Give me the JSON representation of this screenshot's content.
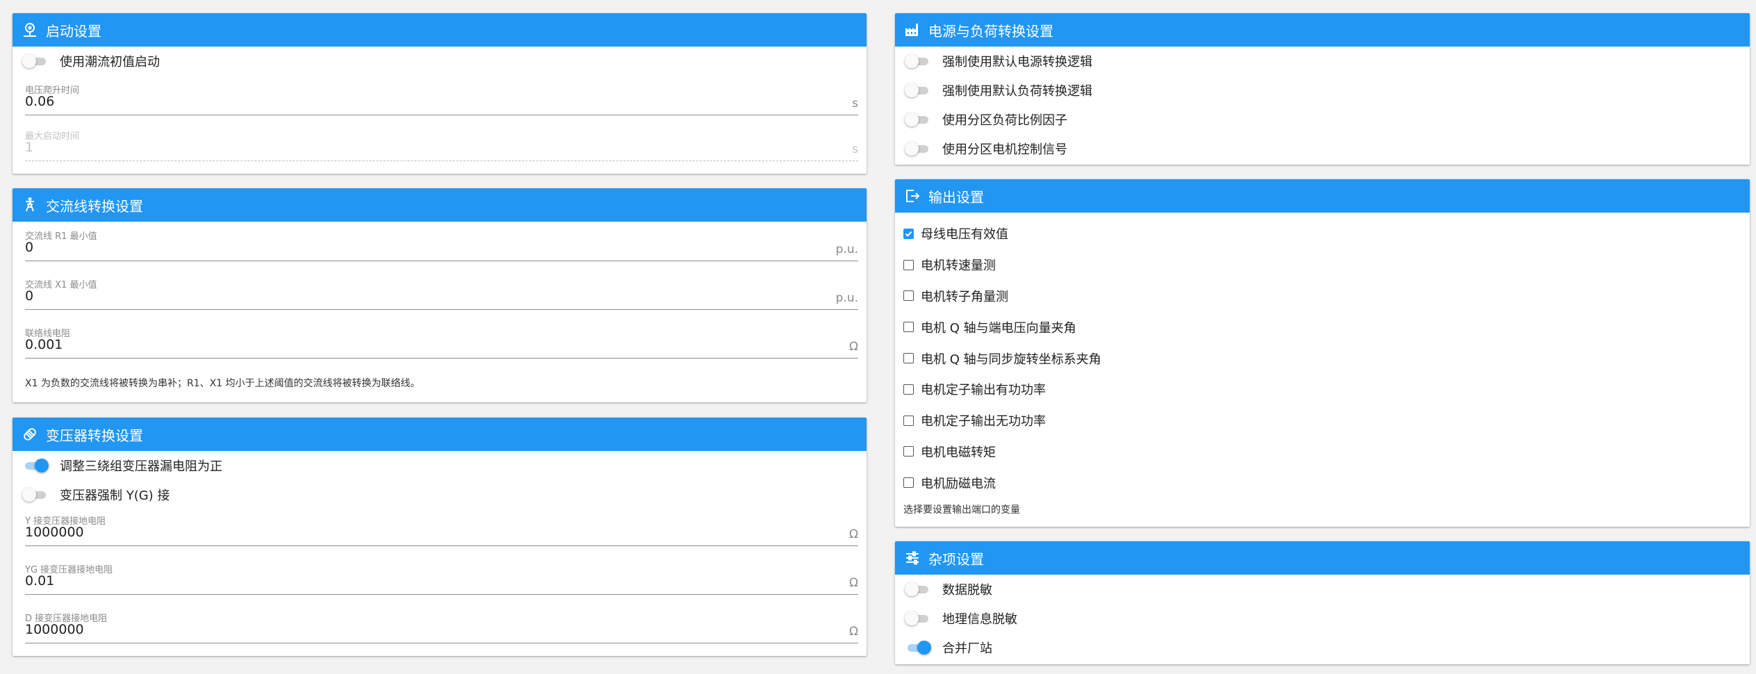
{
  "startup": {
    "title": "启动设置",
    "toggle_label": "使用潮流初值启动",
    "toggle_on": false,
    "voltage_rise": {
      "label": "电压爬升时间",
      "value": "0.06",
      "unit": "s"
    },
    "max_start": {
      "label": "最大启动时间",
      "value": "1",
      "unit": "s"
    }
  },
  "acline": {
    "title": "交流线转换设置",
    "r1": {
      "label": "交流线 R1 最小值",
      "value": "0",
      "unit": "p.u."
    },
    "x1": {
      "label": "交流线 X1 最小值",
      "value": "0",
      "unit": "p.u."
    },
    "tie": {
      "label": "联络线电阻",
      "value": "0.001",
      "unit": "Ω"
    },
    "hint": "X1 为负数的交流线将被转换为串补；R1、X1 均小于上述阈值的交流线将被转换为联络线。"
  },
  "transformer": {
    "title": "变压器转换设置",
    "toggles": [
      {
        "label": "调整三绕组变压器漏电阻为正",
        "on": true
      },
      {
        "label": "变压器强制 Y(G) 接",
        "on": false
      }
    ],
    "y_ground": {
      "label": "Y 接变压器接地电阻",
      "value": "1000000",
      "unit": "Ω"
    },
    "yg_ground": {
      "label": "YG 接变压器接地电阻",
      "value": "0.01",
      "unit": "Ω"
    },
    "d_ground": {
      "label": "D 接变压器接地电阻",
      "value": "1000000",
      "unit": "Ω"
    }
  },
  "power_load": {
    "title": "电源与负荷转换设置",
    "toggles": [
      {
        "label": "强制使用默认电源转换逻辑",
        "on": false
      },
      {
        "label": "强制使用默认负荷转换逻辑",
        "on": false
      },
      {
        "label": "使用分区负荷比例因子",
        "on": false
      },
      {
        "label": "使用分区电机控制信号",
        "on": false
      }
    ]
  },
  "output": {
    "title": "输出设置",
    "checks": [
      {
        "label": "母线电压有效值",
        "checked": true
      },
      {
        "label": "电机转速量测",
        "checked": false
      },
      {
        "label": "电机转子角量测",
        "checked": false
      },
      {
        "label": "电机 Q 轴与端电压向量夹角",
        "checked": false
      },
      {
        "label": "电机 Q 轴与同步旋转坐标系夹角",
        "checked": false
      },
      {
        "label": "电机定子输出有功功率",
        "checked": false
      },
      {
        "label": "电机定子输出无功功率",
        "checked": false
      },
      {
        "label": "电机电磁转矩",
        "checked": false
      },
      {
        "label": "电机励磁电流",
        "checked": false
      }
    ],
    "hint": "选择要设置输出端口的变量"
  },
  "misc": {
    "title": "杂项设置",
    "toggles": [
      {
        "label": "数据脱敏",
        "on": false
      },
      {
        "label": "地理信息脱敏",
        "on": false
      },
      {
        "label": "合并厂站",
        "on": true
      }
    ]
  },
  "colors": {
    "accent": "#2196f3",
    "header_text": "#ffffff",
    "background": "#f2f2f2"
  },
  "icons": {
    "startup": "startup-icon",
    "acline": "transmission-tower-icon",
    "transformer": "transformer-icon",
    "power_load": "factory-icon",
    "output": "export-icon",
    "misc": "tune-icon"
  }
}
